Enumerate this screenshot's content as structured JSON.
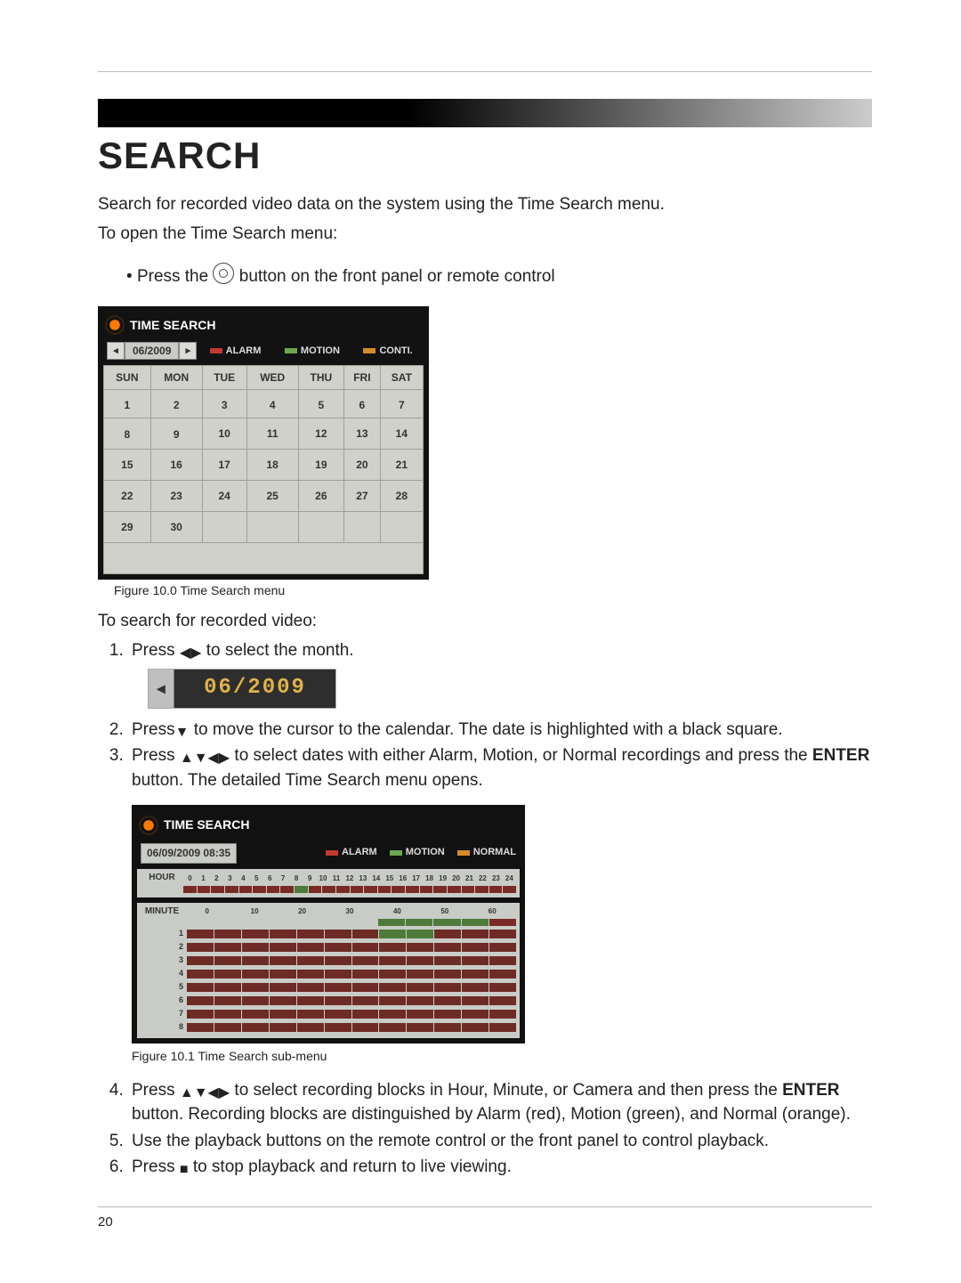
{
  "heading": "SEARCH",
  "intro": "Search for recorded video data on the system using the Time Search menu.",
  "open_line": "To open the Time Search menu:",
  "bullet_press_a": "Press the ",
  "bullet_press_b": " button on the front panel or remote control",
  "fig100": {
    "title": "TIME SEARCH",
    "month": "06/2009",
    "legend": {
      "alarm": "ALARM",
      "motion": "MOTION",
      "conti": "CONTI."
    },
    "dow": [
      "SUN",
      "MON",
      "TUE",
      "WED",
      "THU",
      "FRI",
      "SAT"
    ],
    "weeks": [
      [
        "1",
        "2",
        "3",
        "4",
        "5",
        "6",
        "7"
      ],
      [
        "8",
        "9",
        "10",
        "11",
        "12",
        "13",
        "14"
      ],
      [
        "15",
        "16",
        "17",
        "18",
        "19",
        "20",
        "21"
      ],
      [
        "22",
        "23",
        "24",
        "25",
        "26",
        "27",
        "28"
      ],
      [
        "29",
        "30",
        "",
        "",
        "",
        "",
        ""
      ]
    ],
    "caption": "Figure 10.0 Time Search menu"
  },
  "search_line": "To search for recorded video:",
  "steps": {
    "s1a": "Press ",
    "s1b": " to select the month.",
    "month_strip": "06/2009",
    "s2a": "Press",
    "s2b": " to move the cursor to the calendar. The date is highlighted with a black square.",
    "s3a": "Press ",
    "s3b": " to select dates with either Alarm, Motion, or Normal recordings and press the ",
    "s3c": " button. The detailed Time Search menu opens.",
    "enter": "ENTER",
    "s4a": "Press ",
    "s4b": " to select recording blocks in Hour, Minute, or Camera and then press the ",
    "s4c": " button. Recording blocks are distinguished by Alarm (red), Motion (green), and Normal (orange).",
    "s5": "Use the playback buttons on the remote control or the front panel to control playback.",
    "s6a": "Press ",
    "s6b": " to stop playback and return to live viewing."
  },
  "fig101": {
    "title": "TIME SEARCH",
    "datetime": "06/09/2009 08:35",
    "legend": {
      "alarm": "ALARM",
      "motion": "MOTION",
      "normal": "NORMAL"
    },
    "hour_label": "HOUR",
    "hours": [
      "0",
      "1",
      "2",
      "3",
      "4",
      "5",
      "6",
      "7",
      "8",
      "9",
      "10",
      "11",
      "12",
      "13",
      "14",
      "15",
      "16",
      "17",
      "18",
      "19",
      "20",
      "21",
      "22",
      "23",
      "24"
    ],
    "minute_label": "MINUTE",
    "minutes": [
      "0",
      "10",
      "20",
      "30",
      "40",
      "50",
      "60"
    ],
    "cams": [
      "1",
      "2",
      "3",
      "4",
      "5",
      "6",
      "7",
      "8"
    ],
    "caption": "Figure 10.1 Time Search sub-menu"
  },
  "page_number": "20"
}
